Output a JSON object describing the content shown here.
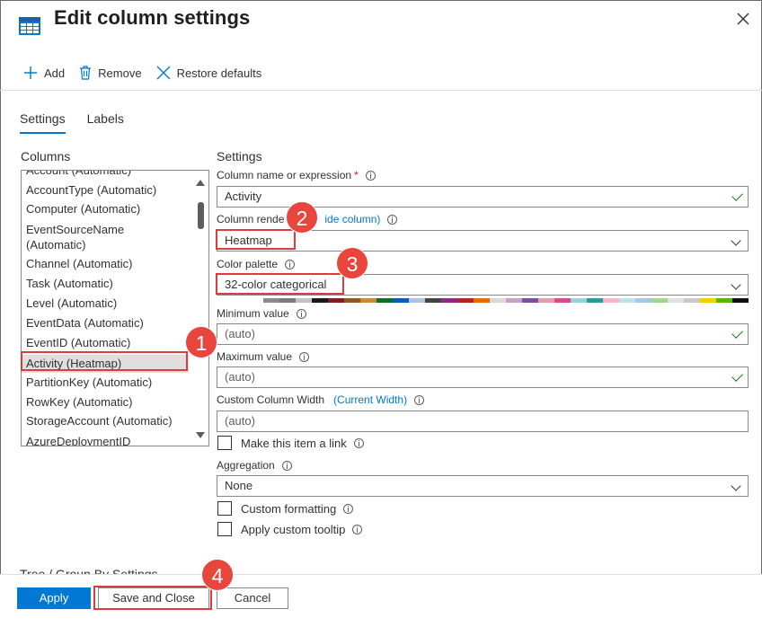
{
  "dialog": {
    "title": "Edit column settings",
    "close_icon": "close-icon",
    "title_icon": "table-icon"
  },
  "toolbar": {
    "add_label": "Add",
    "remove_label": "Remove",
    "restore_label": "Restore defaults"
  },
  "tabs": [
    {
      "label": "Settings",
      "active": true
    },
    {
      "label": "Labels",
      "active": false
    }
  ],
  "columns": {
    "label": "Columns",
    "items": [
      {
        "label": "Account (Automatic)"
      },
      {
        "label": "AccountType (Automatic)"
      },
      {
        "label": "Computer (Automatic)"
      },
      {
        "label": "EventSourceName"
      },
      {
        "label": "(Automatic)"
      },
      {
        "label": "Channel (Automatic)"
      },
      {
        "label": "Task (Automatic)"
      },
      {
        "label": "Level (Automatic)"
      },
      {
        "label": "EventData (Automatic)"
      },
      {
        "label": "EventID (Automatic)"
      },
      {
        "label": "Activity (Heatmap)",
        "selected": true
      },
      {
        "label": "PartitionKey (Automatic)"
      },
      {
        "label": "RowKey (Automatic)"
      },
      {
        "label": "StorageAccount (Automatic)"
      },
      {
        "label": "AzureDeploymentID"
      }
    ]
  },
  "settings": {
    "label": "Settings",
    "column_name_label": "Column name or expression",
    "required_mark": "*",
    "column_name_value": "Activity",
    "renderer_label": "Column rende",
    "renderer_link": "ide column)",
    "renderer_value": "Heatmap",
    "palette_label": "Color palette",
    "palette_value": "32-color categorical",
    "palette_colors": [
      "#ffffff",
      "#ffffff",
      "#8b8b8b",
      "#7a7a7a",
      "#c3c3c3",
      "#1a1a1a",
      "#7f1f1f",
      "#8b5a2b",
      "#c68c3a",
      "#0f6e28",
      "#0a5fb4",
      "#b0c4de",
      "#444444",
      "#8a2b8a",
      "#b32424",
      "#e26b0a",
      "#d8d8d8",
      "#c7a0c7",
      "#7b4f9e",
      "#e0a0b0",
      "#d44c8c",
      "#9ad0d8",
      "#2a9a9a",
      "#f2b8c6",
      "#bbe3e3",
      "#a5c8e6",
      "#9fd78c",
      "#e0e0e0",
      "#c9c9c9",
      "#f5d000",
      "#56b800",
      "#101010"
    ],
    "min_label": "Minimum value",
    "min_placeholder": "(auto)",
    "max_label": "Maximum value",
    "max_placeholder": "(auto)",
    "width_label": "Custom Column Width",
    "width_link": "(Current Width)",
    "width_placeholder": "(auto)",
    "make_link_label": "Make this item a link",
    "aggregation_label": "Aggregation",
    "aggregation_value": "None",
    "custom_formatting_label": "Custom formatting",
    "custom_tooltip_label": "Apply custom tooltip"
  },
  "tree_group_label": "Tree / Group By Settings",
  "footer": {
    "apply_label": "Apply",
    "save_close_label": "Save and Close",
    "cancel_label": "Cancel"
  },
  "annotations": [
    "1",
    "2",
    "3",
    "4"
  ],
  "colors": {
    "accent": "#0078d4",
    "annotation": "#e8453c",
    "valid_check": "#107c10"
  }
}
